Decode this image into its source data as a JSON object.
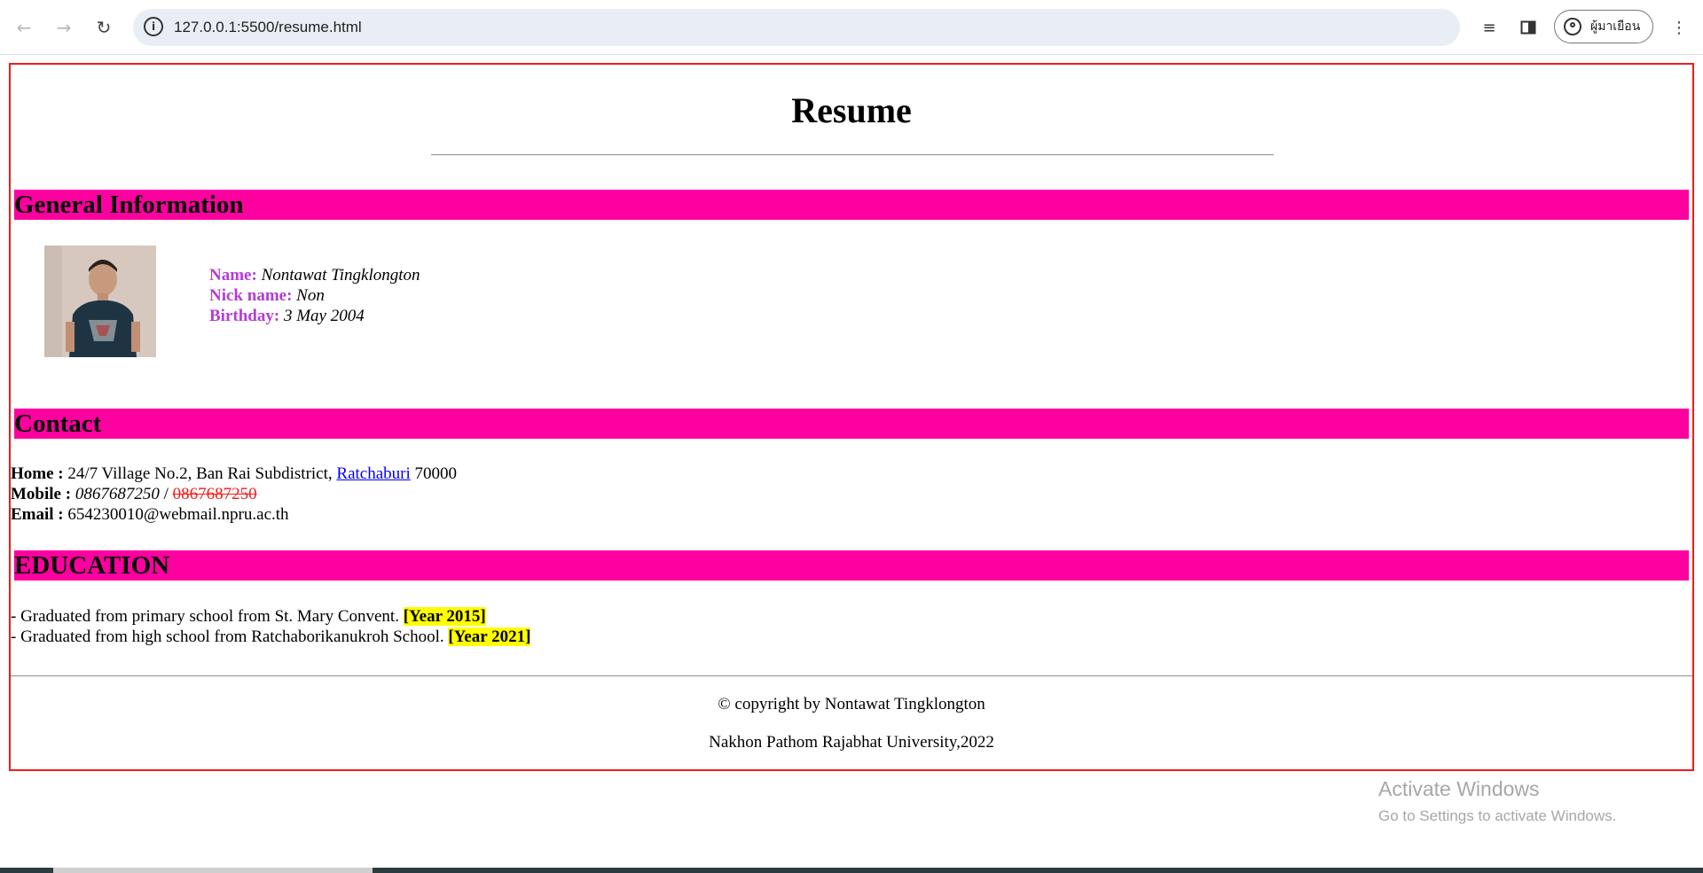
{
  "browser": {
    "url": "127.0.0.1:5500/resume.html",
    "profile_label": "ผู้มาเยือน"
  },
  "page": {
    "title": "Resume",
    "sections": {
      "general": "General Information",
      "contact": "Contact",
      "education": "EDUCATION"
    },
    "general_info": {
      "name_label": "Name:",
      "name_value": "Nontawat Tingklongton",
      "nickname_label": "Nick name:",
      "nickname_value": "Non",
      "birthday_label": "Birthday:",
      "birthday_value": "3 May 2004"
    },
    "contact": {
      "home_label": "Home :",
      "home_address_pre": "24/7 Village No.2, Ban Rai Subdistrict,",
      "home_link": "Ratchaburi",
      "home_postcode": "70000",
      "mobile_label": "Mobile :",
      "mobile_value": "0867687250",
      "mobile_separator": "/",
      "mobile_struck": "0867687250",
      "email_label": "Email :",
      "email_value": "654230010@webmail.npru.ac.th"
    },
    "education": [
      {
        "text": "- Graduated from primary school from St. Mary Convent.",
        "year": "[Year 2015]"
      },
      {
        "text": "- Graduated from high school from Ratchaborikanukroh School.",
        "year": "[Year 2021]"
      }
    ],
    "footer": {
      "copyright": "© copyright by Nontawat Tingklongton",
      "university": "Nakhon Pathom Rajabhat University,2022"
    }
  },
  "watermark": {
    "title": "Activate Windows",
    "subtitle": "Go to Settings to activate Windows."
  },
  "colors": {
    "section_bar": "#ff00a0",
    "frame_border": "#ee1c1c",
    "label_purple": "#b43cd6",
    "highlight": "#ffff00",
    "link": "#0000ee"
  }
}
